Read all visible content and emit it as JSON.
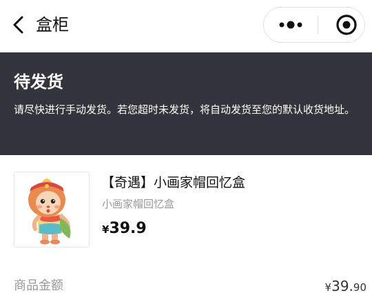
{
  "navbar": {
    "title": "盒柜",
    "back_icon": "chevron-left-icon",
    "menu_icon": "more-dots-icon",
    "close_icon": "target-close-icon"
  },
  "status": {
    "title": "待发货",
    "description": "请尽快进行手动发货。若您超时未发货，将自动发货至您的默认收货地址。",
    "background_color": "#34343c"
  },
  "product": {
    "name": "【奇遇】小画家帽回忆盒",
    "subtitle": "小画家帽回忆盒",
    "currency": "¥",
    "price": "39.9"
  },
  "summary": {
    "amount_label": "商品金额",
    "currency": "¥",
    "amount_int": "39.",
    "amount_dec": "90"
  }
}
